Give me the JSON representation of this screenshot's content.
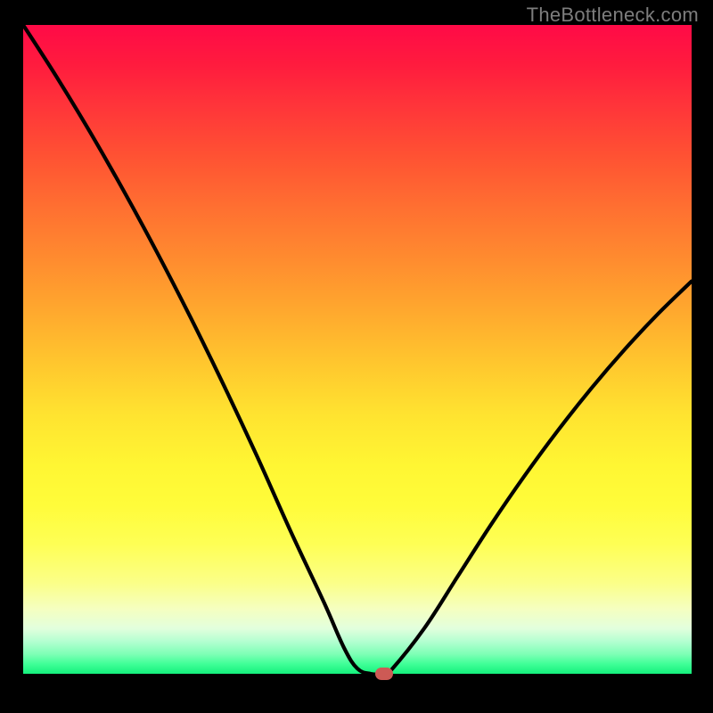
{
  "watermark": "TheBottleneck.com",
  "colors": {
    "frame": "#000000",
    "watermark_text": "#7d7d7d",
    "curve_stroke": "#000000",
    "marker_fill": "#cd5a55",
    "gradient_stops": [
      "#ff0a47",
      "#ff1b3e",
      "#ff333a",
      "#ff5133",
      "#ff6f31",
      "#ff8b2f",
      "#ffa82e",
      "#ffc62e",
      "#ffe330",
      "#fff633",
      "#fffc3a",
      "#feff55",
      "#fbff88",
      "#f5ffc0",
      "#e2ffdd",
      "#b4ffd1",
      "#7dffb5",
      "#3fff97",
      "#14f07c"
    ]
  },
  "chart_data": {
    "type": "line",
    "title": "",
    "xlabel": "",
    "ylabel": "",
    "xlim": [
      0,
      100
    ],
    "ylim": [
      0,
      100
    ],
    "grid": false,
    "legend": false,
    "x": [
      0,
      5,
      10,
      15,
      20,
      25,
      30,
      35,
      40,
      45,
      48,
      50,
      52,
      54,
      55,
      60,
      65,
      70,
      75,
      80,
      85,
      90,
      95,
      100
    ],
    "values": [
      100,
      92,
      83.5,
      74.5,
      65,
      55,
      44.5,
      33.5,
      22,
      11,
      4,
      0.8,
      0,
      0,
      0.5,
      7,
      15,
      23,
      30.5,
      37.5,
      44,
      50,
      55.5,
      60.5
    ],
    "flat_segment": {
      "x_start": 50,
      "x_end": 54,
      "y": 0
    },
    "marker": {
      "x": 54,
      "y": 0
    },
    "notes": "V-shaped bottleneck curve over red→green vertical gradient; minimum (optimal) around x≈52–54 at y≈0. Values read from gradient position, precision ~±2."
  }
}
